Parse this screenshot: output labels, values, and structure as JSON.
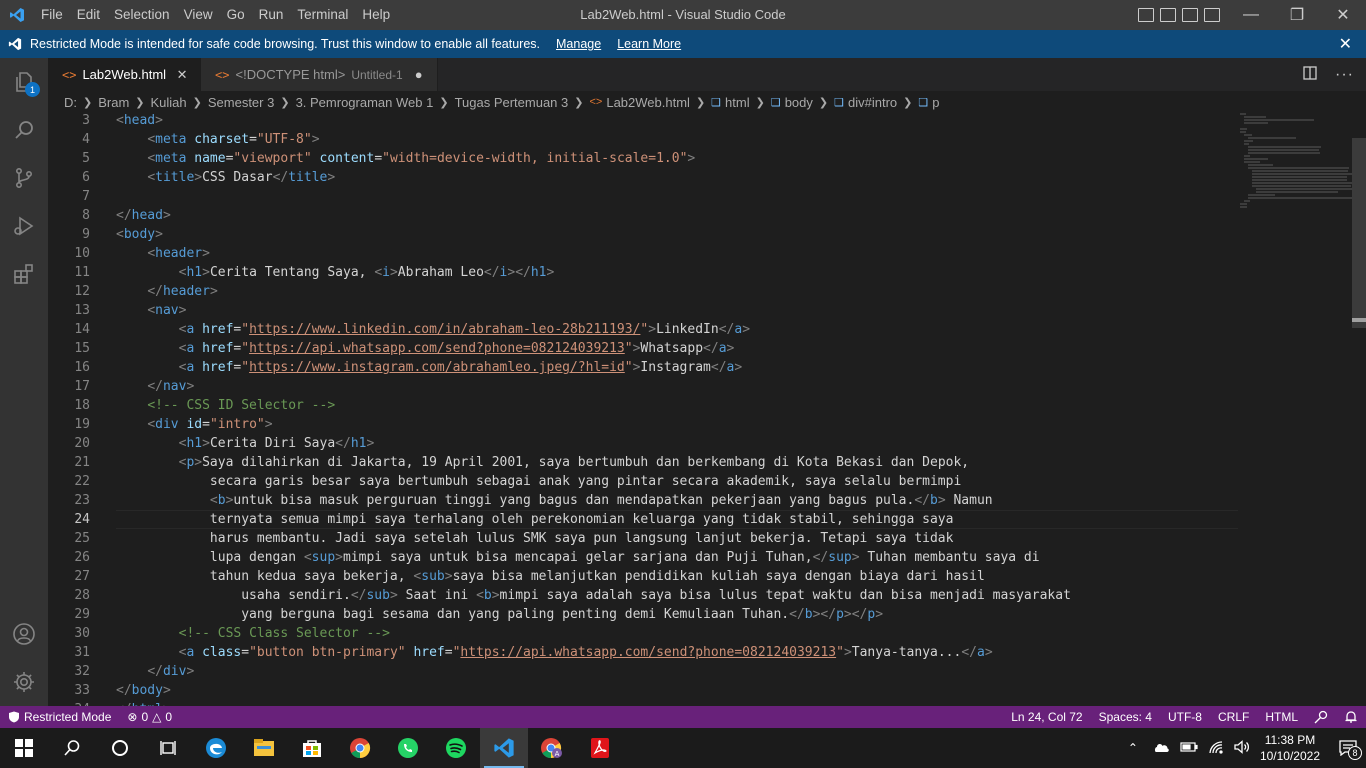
{
  "titlebar": {
    "menu": [
      "File",
      "Edit",
      "Selection",
      "View",
      "Go",
      "Run",
      "Terminal",
      "Help"
    ],
    "title": "Lab2Web.html - Visual Studio Code"
  },
  "banner": {
    "message": "Restricted Mode is intended for safe code browsing. Trust this window to enable all features.",
    "manage": "Manage",
    "learn_more": "Learn More"
  },
  "activity": {
    "explorer_badge": "1"
  },
  "tabs": [
    {
      "label": "Lab2Web.html",
      "icon": "<>"
    },
    {
      "label": "<!DOCTYPE html>",
      "description": "Untitled-1",
      "icon": "<>"
    }
  ],
  "breadcrumb": [
    "D:",
    "Bram",
    "Kuliah",
    "Semester 3",
    "3. Pemrograman Web 1",
    "Tugas Pertemuan 3",
    "Lab2Web.html",
    "html",
    "body",
    "div#intro",
    "p"
  ],
  "editor": {
    "current_line": 24,
    "lines": [
      {
        "n": 3,
        "indent": 0,
        "tokens": [
          [
            "br",
            "<"
          ],
          [
            "tag",
            "head"
          ],
          [
            "br",
            ">"
          ]
        ]
      },
      {
        "n": 4,
        "indent": 4,
        "tokens": [
          [
            "br",
            "<"
          ],
          [
            "tag",
            "meta"
          ],
          [
            "txt",
            " "
          ],
          [
            "attr",
            "charset"
          ],
          [
            "txt",
            "="
          ],
          [
            "str",
            "\"UTF-8\""
          ],
          [
            "br",
            ">"
          ]
        ]
      },
      {
        "n": 5,
        "indent": 4,
        "tokens": [
          [
            "br",
            "<"
          ],
          [
            "tag",
            "meta"
          ],
          [
            "txt",
            " "
          ],
          [
            "attr",
            "name"
          ],
          [
            "txt",
            "="
          ],
          [
            "str",
            "\"viewport\""
          ],
          [
            "txt",
            " "
          ],
          [
            "attr",
            "content"
          ],
          [
            "txt",
            "="
          ],
          [
            "str",
            "\"width=device-width, initial-scale=1.0\""
          ],
          [
            "br",
            ">"
          ]
        ]
      },
      {
        "n": 6,
        "indent": 4,
        "tokens": [
          [
            "br",
            "<"
          ],
          [
            "tag",
            "title"
          ],
          [
            "br",
            ">"
          ],
          [
            "txt",
            "CSS Dasar"
          ],
          [
            "br",
            "</"
          ],
          [
            "tag",
            "title"
          ],
          [
            "br",
            ">"
          ]
        ]
      },
      {
        "n": 7,
        "indent": 0,
        "tokens": []
      },
      {
        "n": 8,
        "indent": 0,
        "tokens": [
          [
            "br",
            "</"
          ],
          [
            "tag",
            "head"
          ],
          [
            "br",
            ">"
          ]
        ]
      },
      {
        "n": 9,
        "indent": 0,
        "tokens": [
          [
            "br",
            "<"
          ],
          [
            "tag",
            "body"
          ],
          [
            "br",
            ">"
          ]
        ]
      },
      {
        "n": 10,
        "indent": 4,
        "tokens": [
          [
            "br",
            "<"
          ],
          [
            "tag",
            "header"
          ],
          [
            "br",
            ">"
          ]
        ]
      },
      {
        "n": 11,
        "indent": 8,
        "tokens": [
          [
            "br",
            "<"
          ],
          [
            "tag",
            "h1"
          ],
          [
            "br",
            ">"
          ],
          [
            "txt",
            "Cerita Tentang Saya, "
          ],
          [
            "br",
            "<"
          ],
          [
            "tag",
            "i"
          ],
          [
            "br",
            ">"
          ],
          [
            "txt",
            "Abraham Leo"
          ],
          [
            "br",
            "</"
          ],
          [
            "tag",
            "i"
          ],
          [
            "br",
            "></"
          ],
          [
            "tag",
            "h1"
          ],
          [
            "br",
            ">"
          ]
        ]
      },
      {
        "n": 12,
        "indent": 4,
        "tokens": [
          [
            "br",
            "</"
          ],
          [
            "tag",
            "header"
          ],
          [
            "br",
            ">"
          ]
        ]
      },
      {
        "n": 13,
        "indent": 4,
        "tokens": [
          [
            "br",
            "<"
          ],
          [
            "tag",
            "nav"
          ],
          [
            "br",
            ">"
          ]
        ]
      },
      {
        "n": 14,
        "indent": 8,
        "tokens": [
          [
            "br",
            "<"
          ],
          [
            "tag",
            "a"
          ],
          [
            "txt",
            " "
          ],
          [
            "attr",
            "href"
          ],
          [
            "txt",
            "="
          ],
          [
            "str",
            "\""
          ],
          [
            "url",
            "https://www.linkedin.com/in/abraham-leo-28b211193/"
          ],
          [
            "str",
            "\""
          ],
          [
            "br",
            ">"
          ],
          [
            "txt",
            "LinkedIn"
          ],
          [
            "br",
            "</"
          ],
          [
            "tag",
            "a"
          ],
          [
            "br",
            ">"
          ]
        ]
      },
      {
        "n": 15,
        "indent": 8,
        "tokens": [
          [
            "br",
            "<"
          ],
          [
            "tag",
            "a"
          ],
          [
            "txt",
            " "
          ],
          [
            "attr",
            "href"
          ],
          [
            "txt",
            "="
          ],
          [
            "str",
            "\""
          ],
          [
            "url",
            "https://api.whatsapp.com/send?phone=082124039213"
          ],
          [
            "str",
            "\""
          ],
          [
            "br",
            ">"
          ],
          [
            "txt",
            "Whatsapp"
          ],
          [
            "br",
            "</"
          ],
          [
            "tag",
            "a"
          ],
          [
            "br",
            ">"
          ]
        ]
      },
      {
        "n": 16,
        "indent": 8,
        "tokens": [
          [
            "br",
            "<"
          ],
          [
            "tag",
            "a"
          ],
          [
            "txt",
            " "
          ],
          [
            "attr",
            "href"
          ],
          [
            "txt",
            "="
          ],
          [
            "str",
            "\""
          ],
          [
            "url",
            "https://www.instagram.com/abrahamleo.jpeg/?hl=id"
          ],
          [
            "str",
            "\""
          ],
          [
            "br",
            ">"
          ],
          [
            "txt",
            "Instagram"
          ],
          [
            "br",
            "</"
          ],
          [
            "tag",
            "a"
          ],
          [
            "br",
            ">"
          ]
        ]
      },
      {
        "n": 17,
        "indent": 4,
        "tokens": [
          [
            "br",
            "</"
          ],
          [
            "tag",
            "nav"
          ],
          [
            "br",
            ">"
          ]
        ]
      },
      {
        "n": 18,
        "indent": 4,
        "tokens": [
          [
            "com",
            "<!-- CSS ID Selector -->"
          ]
        ]
      },
      {
        "n": 19,
        "indent": 4,
        "tokens": [
          [
            "br",
            "<"
          ],
          [
            "tag",
            "div"
          ],
          [
            "txt",
            " "
          ],
          [
            "attr",
            "id"
          ],
          [
            "txt",
            "="
          ],
          [
            "str",
            "\"intro\""
          ],
          [
            "br",
            ">"
          ]
        ]
      },
      {
        "n": 20,
        "indent": 8,
        "tokens": [
          [
            "br",
            "<"
          ],
          [
            "tag",
            "h1"
          ],
          [
            "br",
            ">"
          ],
          [
            "txt",
            "Cerita Diri Saya"
          ],
          [
            "br",
            "</"
          ],
          [
            "tag",
            "h1"
          ],
          [
            "br",
            ">"
          ]
        ]
      },
      {
        "n": 21,
        "indent": 8,
        "tokens": [
          [
            "br",
            "<"
          ],
          [
            "tag",
            "p"
          ],
          [
            "br",
            ">"
          ],
          [
            "txt",
            "Saya dilahirkan di Jakarta, 19 April 2001, saya bertumbuh dan berkembang di Kota Bekasi dan Depok,"
          ]
        ]
      },
      {
        "n": 22,
        "indent": 12,
        "tokens": [
          [
            "txt",
            "secara garis besar saya bertumbuh sebagai anak yang pintar secara akademik, saya selalu bermimpi"
          ]
        ]
      },
      {
        "n": 23,
        "indent": 12,
        "tokens": [
          [
            "br",
            "<"
          ],
          [
            "tag",
            "b"
          ],
          [
            "br",
            ">"
          ],
          [
            "txt",
            "untuk bisa masuk perguruan tinggi yang bagus dan mendapatkan pekerjaan yang bagus pula."
          ],
          [
            "br",
            "</"
          ],
          [
            "tag",
            "b"
          ],
          [
            "br",
            ">"
          ],
          [
            "txt",
            " Namun"
          ]
        ]
      },
      {
        "n": 24,
        "indent": 12,
        "tokens": [
          [
            "txt",
            "ternyata semua mimpi saya terhalang oleh perekonomian keluarga yang tidak stabil, sehingga saya"
          ]
        ]
      },
      {
        "n": 25,
        "indent": 12,
        "tokens": [
          [
            "txt",
            "harus membantu. Jadi saya setelah lulus SMK saya pun langsung lanjut bekerja. Tetapi saya tidak"
          ]
        ]
      },
      {
        "n": 26,
        "indent": 12,
        "tokens": [
          [
            "txt",
            "lupa dengan "
          ],
          [
            "br",
            "<"
          ],
          [
            "tag",
            "sup"
          ],
          [
            "br",
            ">"
          ],
          [
            "txt",
            "mimpi saya untuk bisa mencapai gelar sarjana dan Puji Tuhan,"
          ],
          [
            "br",
            "</"
          ],
          [
            "tag",
            "sup"
          ],
          [
            "br",
            ">"
          ],
          [
            "txt",
            " Tuhan membantu saya di"
          ]
        ]
      },
      {
        "n": 27,
        "indent": 12,
        "tokens": [
          [
            "txt",
            "tahun kedua saya bekerja, "
          ],
          [
            "br",
            "<"
          ],
          [
            "tag",
            "sub"
          ],
          [
            "br",
            ">"
          ],
          [
            "txt",
            "saya bisa melanjutkan pendidikan kuliah saya dengan biaya dari hasil"
          ]
        ]
      },
      {
        "n": 28,
        "indent": 16,
        "tokens": [
          [
            "txt",
            "usaha sendiri."
          ],
          [
            "br",
            "</"
          ],
          [
            "tag",
            "sub"
          ],
          [
            "br",
            ">"
          ],
          [
            "txt",
            " Saat ini "
          ],
          [
            "br",
            "<"
          ],
          [
            "tag",
            "b"
          ],
          [
            "br",
            ">"
          ],
          [
            "txt",
            "mimpi saya adalah saya bisa lulus tepat waktu dan bisa menjadi masyarakat"
          ]
        ]
      },
      {
        "n": 29,
        "indent": 16,
        "tokens": [
          [
            "txt",
            "yang berguna bagi sesama dan yang paling penting demi Kemuliaan Tuhan."
          ],
          [
            "br",
            "</"
          ],
          [
            "tag",
            "b"
          ],
          [
            "br",
            "></"
          ],
          [
            "tag",
            "p"
          ],
          [
            "br",
            "></"
          ],
          [
            "tag",
            "p"
          ],
          [
            "br",
            ">"
          ]
        ]
      },
      {
        "n": 30,
        "indent": 8,
        "tokens": [
          [
            "com",
            "<!-- CSS Class Selector -->"
          ]
        ]
      },
      {
        "n": 31,
        "indent": 8,
        "tokens": [
          [
            "br",
            "<"
          ],
          [
            "tag",
            "a"
          ],
          [
            "txt",
            " "
          ],
          [
            "attr",
            "class"
          ],
          [
            "txt",
            "="
          ],
          [
            "str",
            "\"button btn-primary\""
          ],
          [
            "txt",
            " "
          ],
          [
            "attr",
            "href"
          ],
          [
            "txt",
            "="
          ],
          [
            "str",
            "\""
          ],
          [
            "url",
            "https://api.whatsapp.com/send?phone=082124039213"
          ],
          [
            "str",
            "\""
          ],
          [
            "br",
            ">"
          ],
          [
            "txt",
            "Tanya-tanya..."
          ],
          [
            "br",
            "</"
          ],
          [
            "tag",
            "a"
          ],
          [
            "br",
            ">"
          ]
        ]
      },
      {
        "n": 32,
        "indent": 4,
        "tokens": [
          [
            "br",
            "</"
          ],
          [
            "tag",
            "div"
          ],
          [
            "br",
            ">"
          ]
        ]
      },
      {
        "n": 33,
        "indent": 0,
        "tokens": [
          [
            "br",
            "</"
          ],
          [
            "tag",
            "body"
          ],
          [
            "br",
            ">"
          ]
        ]
      },
      {
        "n": 34,
        "indent": 0,
        "tokens": [
          [
            "br",
            "</"
          ],
          [
            "tag",
            "html"
          ],
          [
            "br",
            ">"
          ]
        ]
      }
    ]
  },
  "status": {
    "restricted": "Restricted Mode",
    "errors": "0",
    "warnings": "0",
    "position": "Ln 24, Col 72",
    "spaces": "Spaces: 4",
    "encoding": "UTF-8",
    "eol": "CRLF",
    "language": "HTML"
  },
  "taskbar": {
    "time": "11:38 PM",
    "date": "10/10/2022",
    "notifications": "8",
    "apps": [
      "start-icon",
      "search-icon",
      "cortana-icon",
      "task-view-icon",
      "edge-icon",
      "file-explorer-icon",
      "store-icon",
      "chrome-icon",
      "whatsapp-icon",
      "spotify-icon",
      "vscode-icon",
      "chrome-profile-icon",
      "acrobat-icon"
    ]
  },
  "colors": {
    "status_bar": "#68217a",
    "banner": "#0e4a7a",
    "tag": "#569cd6",
    "attr": "#9cdcfe",
    "string": "#ce9178",
    "comment": "#6a9955"
  }
}
